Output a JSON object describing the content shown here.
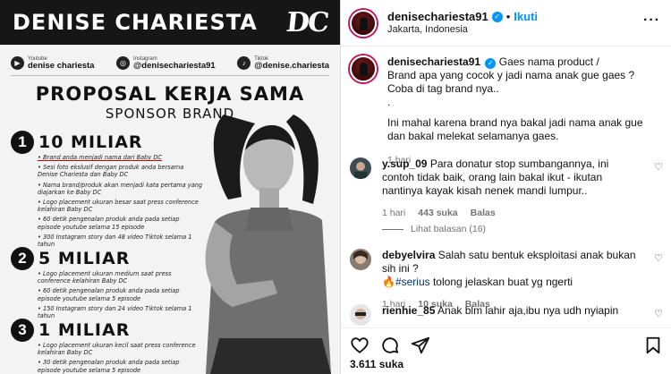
{
  "poster": {
    "header_name": "DENISE CHARIESTA",
    "logo": "DC",
    "socials": [
      {
        "platform": "Youtube",
        "handle": "denise chariesta",
        "icon": "youtube-icon"
      },
      {
        "platform": "Instagram",
        "handle": "@denisechariesta91",
        "icon": "instagram-icon"
      },
      {
        "platform": "Tiktok",
        "handle": "@denise.chariesta",
        "icon": "tiktok-icon"
      }
    ],
    "title": "PROPOSAL KERJA SAMA",
    "subtitle": "SPONSOR BRAND",
    "tiers": [
      {
        "number": "1",
        "amount": "10 MILIAR",
        "bullets": [
          "Brand anda menjadi nama dari Baby DC",
          "Sesi foto ekslusif dengan produk anda bersama Denise Chariesta dan Baby DC",
          "Nama brand/produk akan menjadi kata pertama yang diajarkan ke Baby DC",
          "Logo placement ukuran besar saat press conference kelahiran Baby DC",
          "60 detik pengenalan produk anda pada setiap episode youtube selama 15 episode",
          "300 Instagram story dan 48 video Tiktok selama 1 tahun"
        ]
      },
      {
        "number": "2",
        "amount": "5 MILIAR",
        "bullets": [
          "Logo placement ukuran medium saat press conference kelahiran Baby DC",
          "60 detik pengenalan produk anda pada setiap episode youtube selama 5 episode",
          "150 Instagram story dan 24 video Tiktok selama 1 tahun"
        ]
      },
      {
        "number": "3",
        "amount": "1 MILIAR",
        "bullets": [
          "Logo placement ukuran kecil saat press conference kelahiran Baby DC",
          "30 detik pengenalan produk anda pada setiap episode youtube selama 5 episode"
        ]
      }
    ]
  },
  "post": {
    "username": "denisechariesta91",
    "follow_label": "Ikuti",
    "location": "Jakarta, Indonesia",
    "caption_lines": [
      "Gaes nama product /",
      "Brand apa yang cocok y jadi nama anak gue gaes ? Coba di tag brand nya..",
      ".",
      "Ini mahal karena brand nya bakal jadi nama anak gue dan bakal melekat selamanya gaes."
    ],
    "caption_time": "1 hari"
  },
  "comments": [
    {
      "username": "y.sup_09",
      "text": "Para donatur stop sumbangannya, ini contoh tidak baik, orang lain bakal ikut - ikutan nantinya kayak kisah nenek mandi lumpur..",
      "time": "1 hari",
      "likes": "443 suka",
      "reply": "Balas",
      "view_replies": "Lihat balasan (16)"
    },
    {
      "username": "debyelvira",
      "text_before_tag": "Salah satu bentuk eksploitasi anak bukan sih ini ?",
      "emoji": "🔥",
      "tag": "#serius",
      "text_after_tag": " tolong jelaskan buat yg ngerti",
      "time": "1 hari",
      "likes": "10 suka",
      "reply": "Balas"
    },
    {
      "username": "rienhie_85",
      "text": "Anak blm lahir aja,ibu nya udh nyiapin",
      "time": "",
      "likes": "",
      "reply": ""
    }
  ],
  "likes_count": "3.611 suka",
  "icons": {
    "more": "more-options-icon",
    "like": "heart-icon",
    "comment": "comment-icon",
    "share": "share-icon",
    "save": "bookmark-icon"
  },
  "colors": {
    "accent": "#0095f6",
    "hashtag": "#00376b",
    "muted": "#737373"
  }
}
